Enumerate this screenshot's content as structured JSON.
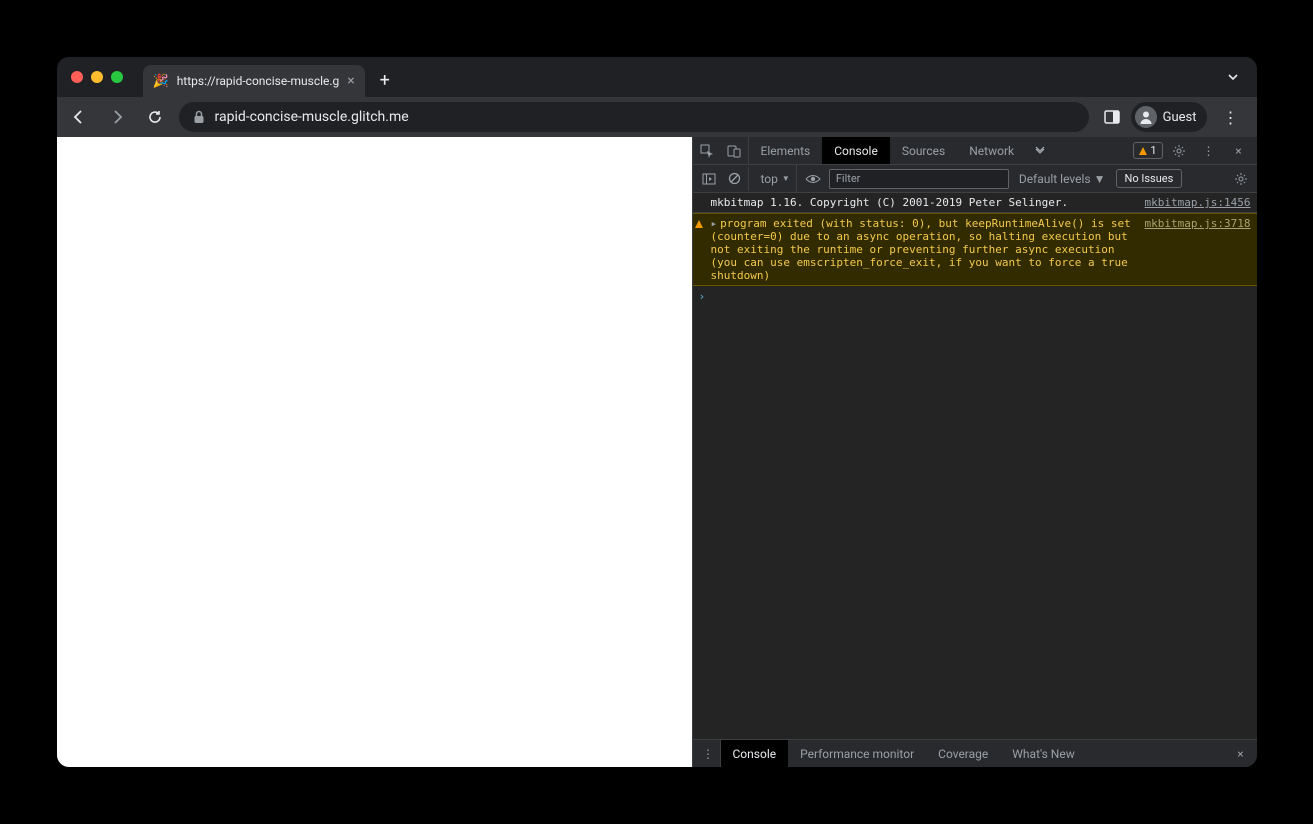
{
  "tab": {
    "title": "https://rapid-concise-muscle.g",
    "favicon": "🎉"
  },
  "omnibox": {
    "url": "rapid-concise-muscle.glitch.me"
  },
  "profile": {
    "label": "Guest"
  },
  "devtools": {
    "tabs": {
      "elements": "Elements",
      "console": "Console",
      "sources": "Sources",
      "network": "Network"
    },
    "warn_count": "1",
    "console_toolbar": {
      "context": "top",
      "filter_placeholder": "Filter",
      "levels": "Default levels",
      "no_issues": "No Issues"
    },
    "logs": {
      "info": {
        "msg": "mkbitmap 1.16. Copyright (C) 2001-2019 Peter Selinger.",
        "src": "mkbitmap.js:1456"
      },
      "warn": {
        "msg": "program exited (with status: 0), but keepRuntimeAlive() is set (counter=0) due to an async operation, so halting execution but not exiting the runtime or preventing further async execution (you can use emscripten_force_exit, if you want to force a true shutdown)",
        "src": "mkbitmap.js:3718"
      }
    },
    "drawer": {
      "console": "Console",
      "perf": "Performance monitor",
      "coverage": "Coverage",
      "whatsnew": "What's New"
    }
  }
}
